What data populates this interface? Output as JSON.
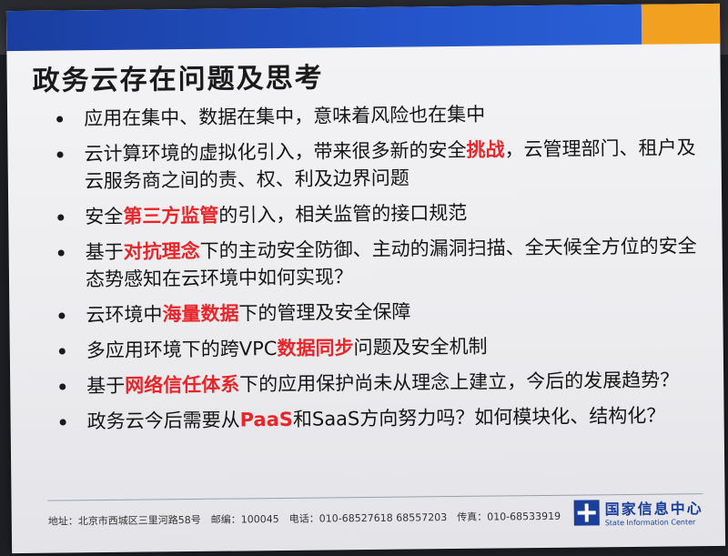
{
  "slide": {
    "title": "政务云存在问题及思考",
    "bullets": [
      {
        "segments": [
          {
            "text": "应用在集中、数据在集中，意味着风险也在集中",
            "hl": false
          }
        ]
      },
      {
        "segments": [
          {
            "text": "云计算环境的虚拟化引入，带来很多新的安全",
            "hl": false
          },
          {
            "text": "挑战",
            "hl": true
          },
          {
            "text": "，云管理部门、租户及云服务商之间的责、权、利及边界问题",
            "hl": false
          }
        ]
      },
      {
        "segments": [
          {
            "text": "安全",
            "hl": false
          },
          {
            "text": "第三方监管",
            "hl": true
          },
          {
            "text": "的引入，相关监管的接口规范",
            "hl": false
          }
        ]
      },
      {
        "segments": [
          {
            "text": "基于",
            "hl": false
          },
          {
            "text": "对抗理念",
            "hl": true
          },
          {
            "text": "下的主动安全防御、主动的漏洞扫描、全天候全方位的安全态势感知在云环境中如何实现？",
            "hl": false
          }
        ]
      },
      {
        "segments": [
          {
            "text": "云环境中",
            "hl": false
          },
          {
            "text": "海量数据",
            "hl": true
          },
          {
            "text": "下的管理及安全保障",
            "hl": false
          }
        ]
      },
      {
        "segments": [
          {
            "text": "多应用环境下的跨VPC",
            "hl": false
          },
          {
            "text": "数据同步",
            "hl": true
          },
          {
            "text": "问题及安全机制",
            "hl": false
          }
        ]
      },
      {
        "segments": [
          {
            "text": "基于",
            "hl": false
          },
          {
            "text": "网络信任体系",
            "hl": true
          },
          {
            "text": "下的应用保护尚未从理念上建立，今后的发展趋势？",
            "hl": false
          }
        ]
      },
      {
        "segments": [
          {
            "text": "政务云今后需要从",
            "hl": false
          },
          {
            "text": "PaaS",
            "hl": true
          },
          {
            "text": "和SaaS方向努力吗？如何模块化、结构化？",
            "hl": false
          }
        ]
      }
    ],
    "footer": {
      "address": "地址：北京市西城区三里河路58号　邮编：100045　电话：010-68527618 68557203　传真：010-68533919",
      "logo_cn": "国家信息中心",
      "logo_en": "State Information Center"
    }
  },
  "colors": {
    "highlight": "#e8262a",
    "top_bar_blue": "#2353c7",
    "top_bar_orange": "#f2a020",
    "logo_blue": "#1a3e9a"
  }
}
